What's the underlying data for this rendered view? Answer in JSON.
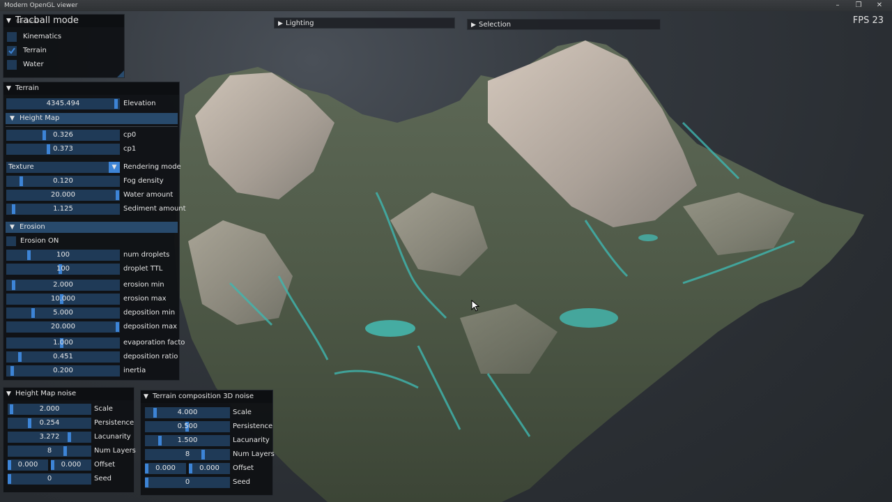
{
  "window": {
    "title": "Modern OpenGL viewer",
    "minimize": "–",
    "maximize": "❐",
    "close": "✕"
  },
  "fps": "FPS 23",
  "colors": {
    "slider_bg": "#1f3a57",
    "grab": "#3d84d6",
    "section": "#284a6c",
    "water": "#3fb7b0"
  },
  "mode_panel": {
    "title": "Tracball mode",
    "title_overlap": "General",
    "items": [
      {
        "label": "Kinematics",
        "checked": false
      },
      {
        "label": "Terrain",
        "checked": true
      },
      {
        "label": "Water",
        "checked": false
      }
    ]
  },
  "top_bars": {
    "lighting": "Lighting",
    "selection": "Selection"
  },
  "terrain": {
    "title": "Terrain",
    "elevation": {
      "value": "4345.494",
      "label": "Elevation",
      "fraction": 0.99
    },
    "height_map": {
      "title": "Height Map",
      "cp0": {
        "value": "0.326",
        "label": "cp0",
        "fraction": 0.33
      },
      "cp1": {
        "value": "0.373",
        "label": "cp1",
        "fraction": 0.37
      }
    },
    "rendering_mode": {
      "value": "Texture",
      "label": "Rendering mode"
    },
    "fog_density": {
      "value": "0.120",
      "label": "Fog density",
      "fraction": 0.12
    },
    "water_amount": {
      "value": "20.000",
      "label": "Water amount",
      "fraction": 1.0
    },
    "sediment_amount": {
      "value": "1.125",
      "label": "Sediment amount",
      "fraction": 0.05
    },
    "erosion": {
      "title": "Erosion",
      "on": {
        "label": "Erosion ON",
        "checked": false
      },
      "params": [
        {
          "value": "100",
          "label": "num droplets",
          "fraction": 0.19
        },
        {
          "value": "100",
          "label": "droplet TTL",
          "fraction": 0.48
        },
        {
          "value": "2.000",
          "label": "erosion min",
          "fraction": 0.05
        },
        {
          "value": "10.000",
          "label": "erosion max",
          "fraction": 0.49
        },
        {
          "value": "5.000",
          "label": "deposition min",
          "fraction": 0.23
        },
        {
          "value": "20.000",
          "label": "deposition max",
          "fraction": 1.0
        },
        {
          "value": "1.000",
          "label": "evaporation facto",
          "fraction": 0.49
        },
        {
          "value": "0.451",
          "label": "deposition ratio",
          "fraction": 0.11
        },
        {
          "value": "0.200",
          "label": "inertia",
          "fraction": 0.04
        }
      ]
    }
  },
  "hm_noise": {
    "title": "Height Map noise",
    "scale": {
      "value": "2.000",
      "label": "Scale",
      "fraction": 0.03
    },
    "persistence": {
      "value": "0.254",
      "label": "Persistence",
      "fraction": 0.25
    },
    "lacunarity": {
      "value": "3.272",
      "label": "Lacunarity",
      "fraction": 0.75
    },
    "num_layers": {
      "value": "8",
      "label": "Num Layers",
      "fraction": 0.7
    },
    "offset": {
      "x": "0.000",
      "y": "0.000",
      "label": "Offset"
    },
    "seed": {
      "value": "0",
      "label": "Seed",
      "fraction": 0.0
    }
  },
  "tc_noise": {
    "title": "Terrain composition 3D noise",
    "scale": {
      "value": "4.000",
      "label": "Scale",
      "fraction": 0.1
    },
    "persistence": {
      "value": "0.500",
      "label": "Persistence",
      "fraction": 0.5
    },
    "lacunarity": {
      "value": "1.500",
      "label": "Lacunarity",
      "fraction": 0.16
    },
    "num_layers": {
      "value": "8",
      "label": "Num Layers",
      "fraction": 0.7
    },
    "offset": {
      "x": "0.000",
      "y": "0.000",
      "label": "Offset"
    },
    "seed": {
      "value": "0",
      "label": "Seed",
      "fraction": 0.0
    }
  }
}
